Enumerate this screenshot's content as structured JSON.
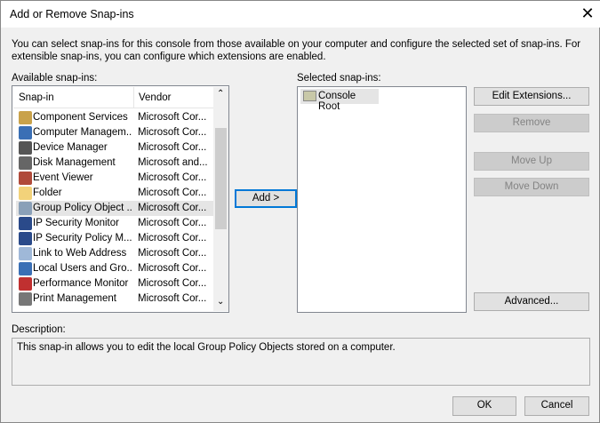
{
  "window": {
    "title": "Add or Remove Snap-ins",
    "close": "✕"
  },
  "intro": "You can select snap-ins for this console from those available on your computer and configure the selected set of snap-ins. For extensible snap-ins, you can configure which extensions are enabled.",
  "available": {
    "label": "Available snap-ins:",
    "columns": [
      "Snap-in",
      "Vendor"
    ],
    "items": [
      {
        "name": "Component Services",
        "vendor": "Microsoft Cor...",
        "color": "#c9a24a"
      },
      {
        "name": "Computer Managem...",
        "vendor": "Microsoft Cor...",
        "color": "#3a6fb5"
      },
      {
        "name": "Device Manager",
        "vendor": "Microsoft Cor...",
        "color": "#555555"
      },
      {
        "name": "Disk Management",
        "vendor": "Microsoft and...",
        "color": "#666666"
      },
      {
        "name": "Event Viewer",
        "vendor": "Microsoft Cor...",
        "color": "#b04a3a"
      },
      {
        "name": "Folder",
        "vendor": "Microsoft Cor...",
        "color": "#f2d27a"
      },
      {
        "name": "Group Policy Object ...",
        "vendor": "Microsoft Cor...",
        "color": "#8aa0b8"
      },
      {
        "name": "IP Security Monitor",
        "vendor": "Microsoft Cor...",
        "color": "#2a4a8a"
      },
      {
        "name": "IP Security Policy M...",
        "vendor": "Microsoft Cor...",
        "color": "#2a4a8a"
      },
      {
        "name": "Link to Web Address",
        "vendor": "Microsoft Cor...",
        "color": "#9fb8d8"
      },
      {
        "name": "Local Users and Gro...",
        "vendor": "Microsoft Cor...",
        "color": "#3a6fb5"
      },
      {
        "name": "Performance Monitor",
        "vendor": "Microsoft Cor...",
        "color": "#c03030"
      },
      {
        "name": "Print Management",
        "vendor": "Microsoft Cor...",
        "color": "#777777"
      }
    ]
  },
  "add_button": "Add >",
  "selected": {
    "label": "Selected snap-ins:",
    "items": [
      "Console Root"
    ]
  },
  "buttons": {
    "edit_extensions": "Edit Extensions...",
    "remove": "Remove",
    "move_up": "Move Up",
    "move_down": "Move Down",
    "advanced": "Advanced...",
    "ok": "OK",
    "cancel": "Cancel"
  },
  "description": {
    "label": "Description:",
    "text": "This snap-in allows you to edit the local Group Policy Objects stored on a computer."
  }
}
